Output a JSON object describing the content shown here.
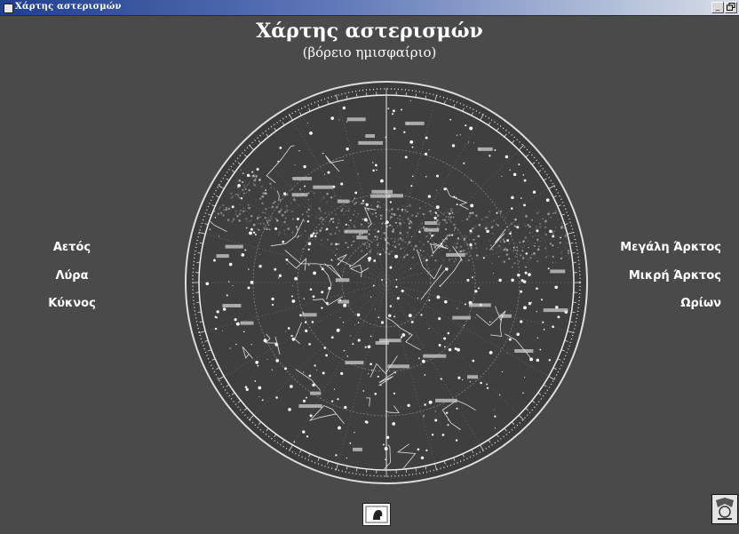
{
  "window": {
    "title": "Χάρτης αστερισμών",
    "minimize_glyph": "_",
    "restore_glyph": "🗗"
  },
  "header": {
    "title": "Χάρτης αστερισμών",
    "subtitle": "(βόρειο ημισφαίριο)"
  },
  "left_links": [
    {
      "label": "Αετός"
    },
    {
      "label": "Λύρα"
    },
    {
      "label": "Κύκνος"
    }
  ],
  "right_links": [
    {
      "label": "Μεγάλη Άρκτος"
    },
    {
      "label": "Μικρή Άρκτος"
    },
    {
      "label": "Ωρίων"
    }
  ],
  "icons": {
    "app": "app-icon",
    "star_map": "star-chart-image",
    "bottom_button": "person-head-icon",
    "corner": "corner-logo-icon"
  },
  "colors": {
    "background": "#4a4a4a",
    "text": "#ffffff",
    "titlebar_start": "#1f3f8f"
  }
}
